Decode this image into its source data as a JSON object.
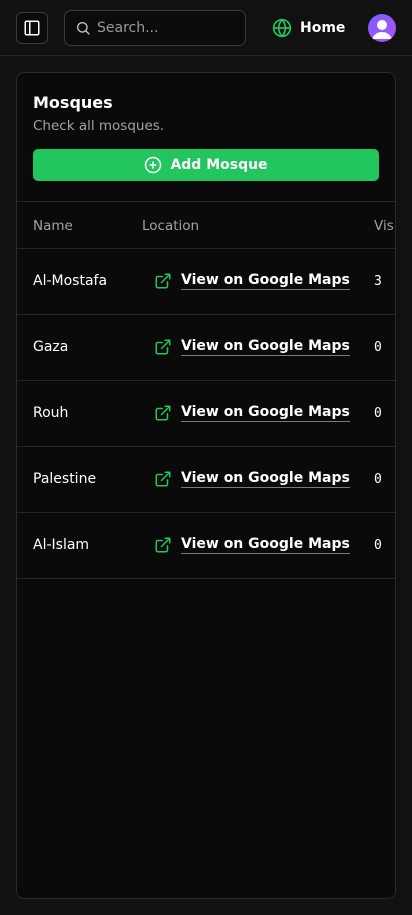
{
  "topbar": {
    "search": {
      "placeholder": "Search..."
    },
    "home_label": "Home",
    "accent": "#22c55e"
  },
  "card": {
    "title": "Mosques",
    "subtitle": "Check all mosques.",
    "add_button_label": "Add Mosque",
    "button_color": "#22c55e"
  },
  "table": {
    "headers": {
      "name": "Name",
      "location": "Location",
      "visits": "Vis"
    },
    "link_label": "View on Google Maps",
    "rows": [
      {
        "name": "Al-Mostafa",
        "visits": "3"
      },
      {
        "name": "Gaza",
        "visits": "0"
      },
      {
        "name": "Rouh",
        "visits": "0"
      },
      {
        "name": "Palestine",
        "visits": "0"
      },
      {
        "name": "Al-Islam",
        "visits": "0"
      }
    ]
  },
  "icons": {
    "sidebar": "sidebar-toggle-icon",
    "search": "search-icon",
    "home": "globe-icon",
    "avatar": "user-avatar-icon",
    "add": "plus-circle-icon",
    "external": "external-link-icon"
  }
}
